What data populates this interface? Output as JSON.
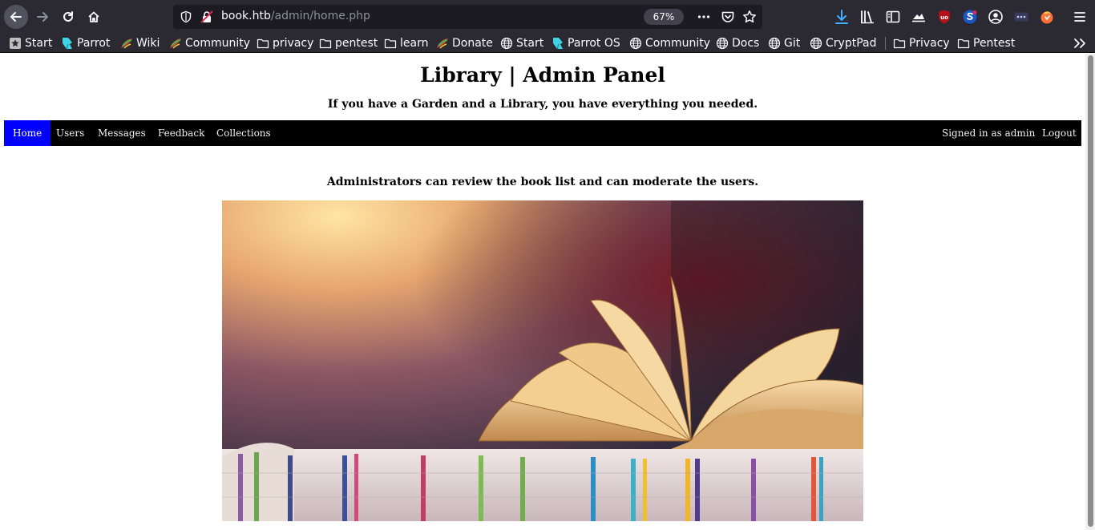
{
  "browser": {
    "url_host": "book.htb",
    "url_path": "/admin/home.php",
    "zoom": "67%"
  },
  "bookmarks": [
    {
      "label": "Start",
      "icon": "start-star-icon"
    },
    {
      "label": "Parrot",
      "icon": "parrot-icon"
    },
    {
      "label": "Wiki",
      "icon": "parrot-colored-icon"
    },
    {
      "label": "Community",
      "icon": "parrot-colored-icon"
    },
    {
      "label": "privacy",
      "icon": "folder-icon"
    },
    {
      "label": "pentest",
      "icon": "folder-icon"
    },
    {
      "label": "learn",
      "icon": "folder-icon"
    },
    {
      "label": "Donate",
      "icon": "parrot-colored-icon"
    },
    {
      "label": "Start",
      "icon": "globe-icon"
    },
    {
      "label": "Parrot OS",
      "icon": "parrot-icon"
    },
    {
      "label": "Community",
      "icon": "globe-icon"
    },
    {
      "label": "Docs",
      "icon": "globe-icon"
    },
    {
      "label": "Git",
      "icon": "globe-icon"
    },
    {
      "label": "CryptPad",
      "icon": "globe-icon"
    },
    {
      "label": "Privacy",
      "icon": "folder-icon"
    },
    {
      "label": "Pentest",
      "icon": "folder-icon"
    }
  ],
  "page": {
    "title": "Library | Admin Panel",
    "subtitle": "If you have a Garden and a Library, you have everything you needed.",
    "nav": {
      "left": [
        "Home",
        "Users",
        "Messages",
        "Feedback",
        "Collections"
      ],
      "right": [
        "Signed in as admin",
        "Logout"
      ],
      "active": "Home"
    },
    "intro": "Administrators can review the book list and can moderate the users."
  },
  "colors": {
    "browser_chrome": "#2b2a33",
    "nav_bar": "#000000",
    "nav_active": "#0000ff",
    "download_accent": "#3fb0ff"
  }
}
